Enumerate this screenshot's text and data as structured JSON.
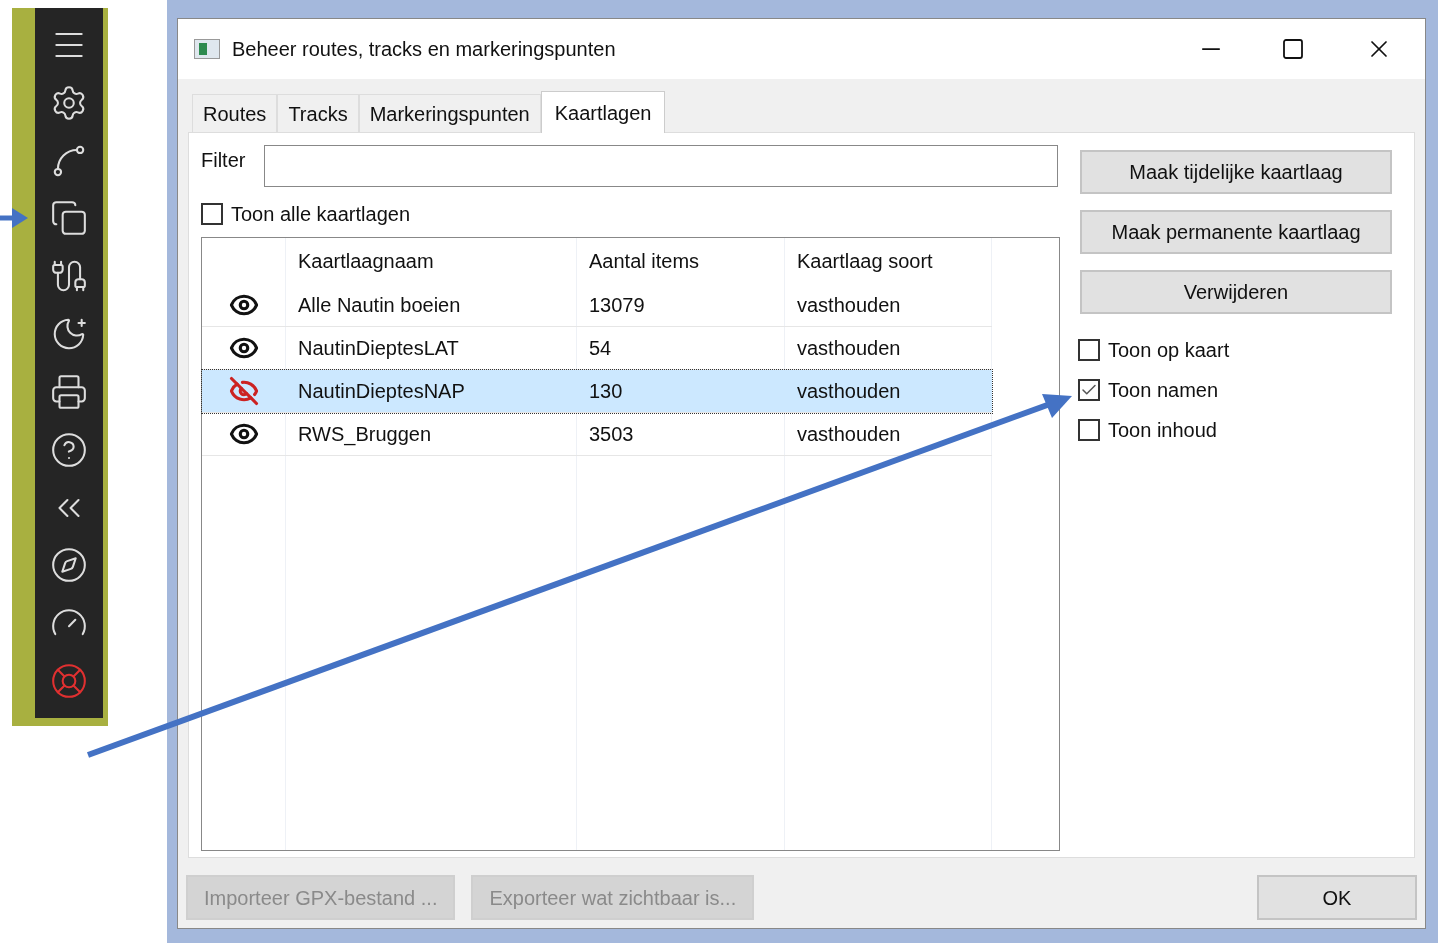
{
  "window": {
    "title": "Beheer routes, tracks en markeringspunten"
  },
  "tabs": [
    {
      "label": "Routes",
      "selected": false
    },
    {
      "label": "Tracks",
      "selected": false
    },
    {
      "label": "Markeringspunten",
      "selected": false
    },
    {
      "label": "Kaartlagen",
      "selected": true
    }
  ],
  "filter": {
    "label": "Filter"
  },
  "show_all": {
    "label": "Toon alle kaartlagen",
    "checked": false
  },
  "table": {
    "columns": [
      "Kaartlaagnaam",
      "Aantal items",
      "Kaartlaag soort"
    ],
    "rows": [
      {
        "visible": true,
        "selected": false,
        "cells": [
          "Alle Nautin boeien",
          "13079",
          "vasthouden"
        ]
      },
      {
        "visible": true,
        "selected": false,
        "cells": [
          "NautinDieptesLAT",
          "54",
          "vasthouden"
        ]
      },
      {
        "visible": false,
        "selected": true,
        "cells": [
          "NautinDieptesNAP",
          "130",
          "vasthouden"
        ]
      },
      {
        "visible": true,
        "selected": false,
        "cells": [
          "RWS_Bruggen",
          "3503",
          "vasthouden"
        ]
      }
    ]
  },
  "side_buttons": [
    "Maak tijdelijke kaartlaag",
    "Maak permanente kaartlaag",
    "Verwijderen"
  ],
  "options": [
    {
      "label": "Toon op kaart",
      "checked": false
    },
    {
      "label": "Toon namen",
      "checked": true
    },
    {
      "label": "Toon inhoud",
      "checked": false
    }
  ],
  "footer_buttons": [
    {
      "label": "Importeer GPX-bestand ...",
      "disabled": true
    },
    {
      "label": "Exporteer wat zichtbaar is...",
      "disabled": true
    },
    {
      "label": "OK",
      "disabled": false
    }
  ]
}
